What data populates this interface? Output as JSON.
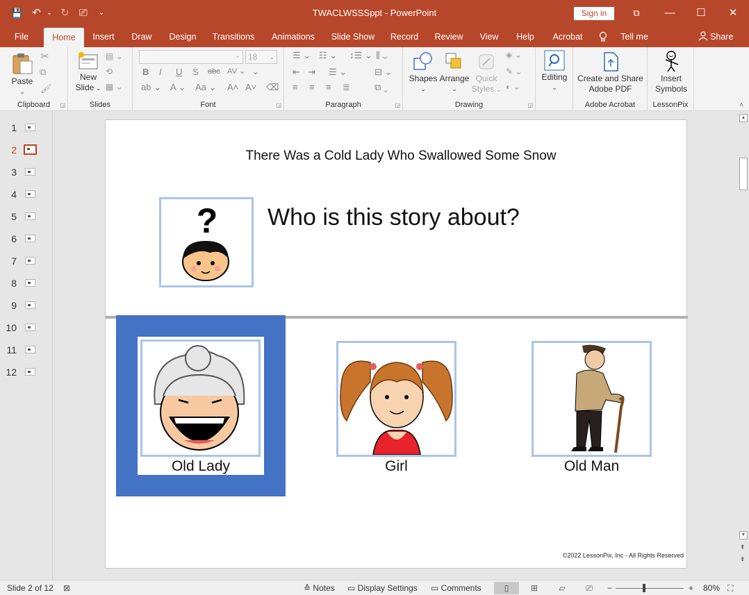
{
  "titlebar": {
    "doc_title": "TWACLWSSSppt  -  PowerPoint",
    "sign_in": "Sign in",
    "minimize": "—",
    "maximize": "☐",
    "close": "✕",
    "ribbon_display": "⧉"
  },
  "qat": {
    "save": "💾",
    "undo": "↶",
    "undo_dd": "⌄",
    "redo": "↻",
    "present": "⎚",
    "customize": "⌄"
  },
  "tabs": [
    "File",
    "Home",
    "Insert",
    "Draw",
    "Design",
    "Transitions",
    "Animations",
    "Slide Show",
    "Record",
    "Review",
    "View",
    "Help",
    "Acrobat",
    "Tell me",
    "Share"
  ],
  "ribbon": {
    "clipboard": {
      "label": "Clipboard",
      "paste": "Paste"
    },
    "slides": {
      "label": "Slides",
      "new_slide_line1": "New",
      "new_slide_line2": "Slide"
    },
    "font": {
      "label": "Font",
      "font_name": "",
      "font_size": "18"
    },
    "paragraph": {
      "label": "Paragraph"
    },
    "drawing": {
      "label": "Drawing",
      "shapes": "Shapes",
      "arrange": "Arrange",
      "quick_styles_line1": "Quick",
      "quick_styles_line2": "Styles"
    },
    "editing": {
      "label": "Editing"
    },
    "acrobat": {
      "label": "Adobe Acrobat",
      "line1": "Create and Share",
      "line2": "Adobe PDF"
    },
    "lessonpix": {
      "label": "LessonPix",
      "line1": "Insert",
      "line2": "Symbols"
    }
  },
  "thumbnails": [
    "1",
    "2",
    "3",
    "4",
    "5",
    "6",
    "7",
    "8",
    "9",
    "10",
    "11",
    "12"
  ],
  "current_slide_index": 2,
  "slide": {
    "title": "There Was a Cold Lady Who Swallowed Some Snow",
    "question": "Who is this story about?",
    "choices": [
      {
        "caption": "Old Lady",
        "selected": true
      },
      {
        "caption": "Girl",
        "selected": false
      },
      {
        "caption": "Old Man",
        "selected": false
      }
    ],
    "copyright": "©2022 LessonPix, Inc - All Rights Reserved"
  },
  "status": {
    "slide_of": "Slide 2 of 12",
    "notes": "Notes",
    "display_settings": "Display Settings",
    "comments": "Comments",
    "zoom": "80%",
    "zoom_minus": "−",
    "zoom_plus": "+"
  },
  "colors": {
    "accent": "#b7472a",
    "selection": "#4472c4",
    "card_border": "#a9c5e8"
  }
}
